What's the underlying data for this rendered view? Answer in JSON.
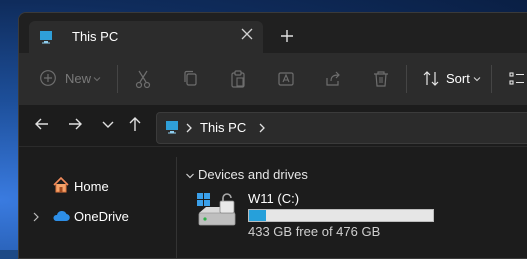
{
  "window": {
    "tab_title": "This PC",
    "tab_icon": "pc-icon",
    "new_tab_icon": "plus-icon",
    "close_tab_icon": "close-icon"
  },
  "toolbar": {
    "new_label": "New",
    "sort_label": "Sort",
    "buttons": [
      "cut-icon",
      "copy-icon",
      "paste-icon",
      "rename-icon",
      "share-icon",
      "delete-icon"
    ]
  },
  "address": {
    "path": "This PC",
    "separator": ">"
  },
  "nav_pane": {
    "items": [
      {
        "label": "Home",
        "icon": "home-icon"
      },
      {
        "label": "OneDrive",
        "icon": "cloud-icon"
      }
    ]
  },
  "main": {
    "section_title": "Devices and drives",
    "drive": {
      "name": "W11 (C:)",
      "free_text": "433 GB free of 476 GB",
      "used_fraction": 0.09
    }
  },
  "colors": {
    "accent": "#26a0da",
    "window_bg": "#1c1c1c",
    "toolbar_bg": "#2c2c2c"
  }
}
